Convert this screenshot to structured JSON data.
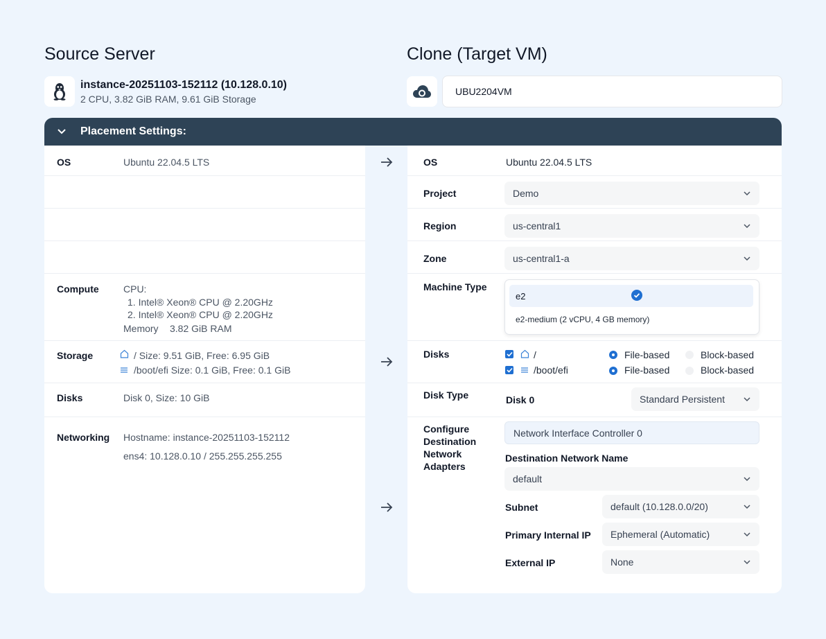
{
  "source": {
    "heading": "Source Server",
    "name": "instance-20251103-152112 (10.128.0.10)",
    "specs": "2 CPU, 3.82 GiB RAM, 9.61 GiB Storage",
    "icon": "linux-penguin-icon"
  },
  "target": {
    "heading": "Clone (Target VM)",
    "vm_name": "UBU2204VM",
    "icon": "cloud-icon"
  },
  "banner": {
    "title": "Placement Settings:"
  },
  "left": {
    "os": {
      "label": "OS",
      "value": "Ubuntu 22.04.5 LTS"
    },
    "compute": {
      "label": "Compute",
      "cpu_label": "CPU:",
      "cpus": [
        "1.  Intel® Xeon® CPU @ 2.20GHz",
        "2.  Intel® Xeon® CPU @ 2.20GHz"
      ],
      "memory_label": "Memory",
      "memory_value": "3.82 GiB RAM"
    },
    "storage": {
      "label": "Storage",
      "items": [
        {
          "icon": "home-icon",
          "text": "/ Size: 9.51 GiB, Free: 6.95 GiB"
        },
        {
          "icon": "list-icon",
          "text": "/boot/efi Size: 0.1 GiB, Free: 0.1 GiB"
        }
      ]
    },
    "disks": {
      "label": "Disks",
      "value": "Disk 0, Size: 10 GiB"
    },
    "networking": {
      "label": "Networking",
      "hostname": "Hostname: instance-20251103-152112",
      "interface": "ens4: 10.128.0.10 / 255.255.255.255"
    }
  },
  "right": {
    "os": {
      "label": "OS",
      "value": "Ubuntu 22.04.5 LTS"
    },
    "project": {
      "label": "Project",
      "value": "Demo"
    },
    "region": {
      "label": "Region",
      "value": "us-central1"
    },
    "zone": {
      "label": "Zone",
      "value": "us-central1-a"
    },
    "machine_type": {
      "label": "Machine Type",
      "selected": "e2",
      "option": "e2-medium (2 vCPU, 4 GB memory)"
    },
    "disks": {
      "label": "Disks",
      "items": [
        {
          "icon": "home-icon",
          "path": "/",
          "opt1": "File-based",
          "opt2": "Block-based"
        },
        {
          "icon": "list-icon",
          "path": "/boot/efi",
          "opt1": "File-based",
          "opt2": "Block-based"
        }
      ]
    },
    "disk_type": {
      "label": "Disk Type",
      "disk": "Disk 0",
      "value": "Standard Persistent"
    },
    "network": {
      "label_lines": [
        "Configure",
        "Destination",
        "Network",
        "Adapters"
      ],
      "nic": "Network Interface Controller 0",
      "dest_label": "Destination Network Name",
      "dest_value": "default",
      "subnet_label": "Subnet",
      "subnet_value": "default (10.128.0.0/20)",
      "internal_ip_label": "Primary Internal IP",
      "internal_ip_value": "Ephemeral (Automatic)",
      "external_ip_label": "External IP",
      "external_ip_value": "None"
    }
  },
  "colors": {
    "background": "#eef5fd",
    "banner": "#2e4356",
    "accent": "#1f6fd1"
  }
}
